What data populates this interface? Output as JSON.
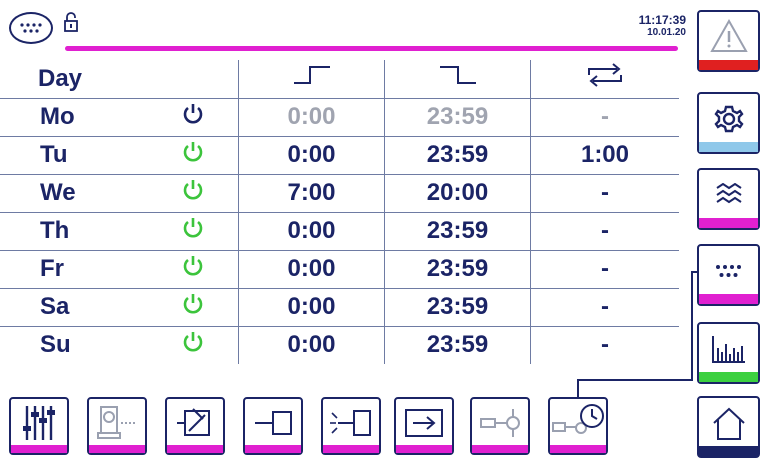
{
  "header": {
    "time": "11:17:39",
    "date": "10.01.20"
  },
  "table": {
    "header_day": "Day",
    "rows": [
      {
        "day": "Mo",
        "on": "0:00",
        "off": "23:59",
        "cycle": "-",
        "active": false
      },
      {
        "day": "Tu",
        "on": "0:00",
        "off": "23:59",
        "cycle": "1:00",
        "active": true
      },
      {
        "day": "We",
        "on": "7:00",
        "off": "20:00",
        "cycle": "-",
        "active": true
      },
      {
        "day": "Th",
        "on": "0:00",
        "off": "23:59",
        "cycle": "-",
        "active": true
      },
      {
        "day": "Fr",
        "on": "0:00",
        "off": "23:59",
        "cycle": "-",
        "active": true
      },
      {
        "day": "Sa",
        "on": "0:00",
        "off": "23:59",
        "cycle": "-",
        "active": true
      },
      {
        "day": "Su",
        "on": "0:00",
        "off": "23:59",
        "cycle": "-",
        "active": true
      }
    ]
  },
  "colors": {
    "accent": "#e020d0",
    "navy": "#1b2466",
    "power_on": "#3cc43c",
    "alarm": "#e02020",
    "settings": "#8fc8ea",
    "chart": "#3cd040"
  },
  "sidebar": [
    "alarm-icon",
    "gear-icon",
    "waves-icon",
    "dots-icon",
    "chart-icon",
    "home-icon"
  ],
  "toolbar": [
    "sliders-icon",
    "pump-icon",
    "valve-icon",
    "cylinder-icon",
    "sensor-icon",
    "arrow-in-icon",
    "device-icon",
    "device-timer-icon"
  ]
}
